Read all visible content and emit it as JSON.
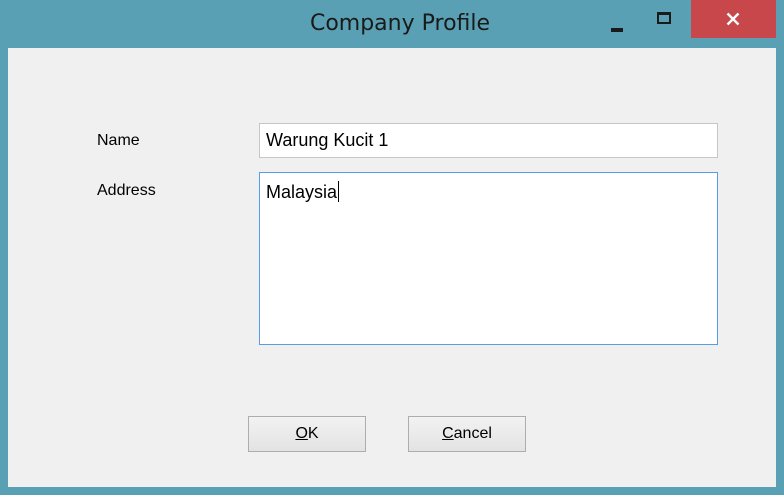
{
  "window": {
    "title": "Company Profile",
    "controls": {
      "minimize_icon": "minimize-icon",
      "maximize_icon": "maximize-icon",
      "close_icon": "close-icon"
    },
    "colors": {
      "frame": "#5aa0b4",
      "close_button": "#c7474b",
      "client_background": "#f0f0f0",
      "focus_border": "#569de5"
    }
  },
  "form": {
    "name": {
      "label": "Name",
      "value": "Warung Kucit 1"
    },
    "address": {
      "label": "Address",
      "value": "Malaysia"
    }
  },
  "buttons": {
    "ok": {
      "mnemonic": "O",
      "rest": "K"
    },
    "cancel": {
      "mnemonic": "C",
      "rest": "ancel"
    }
  }
}
